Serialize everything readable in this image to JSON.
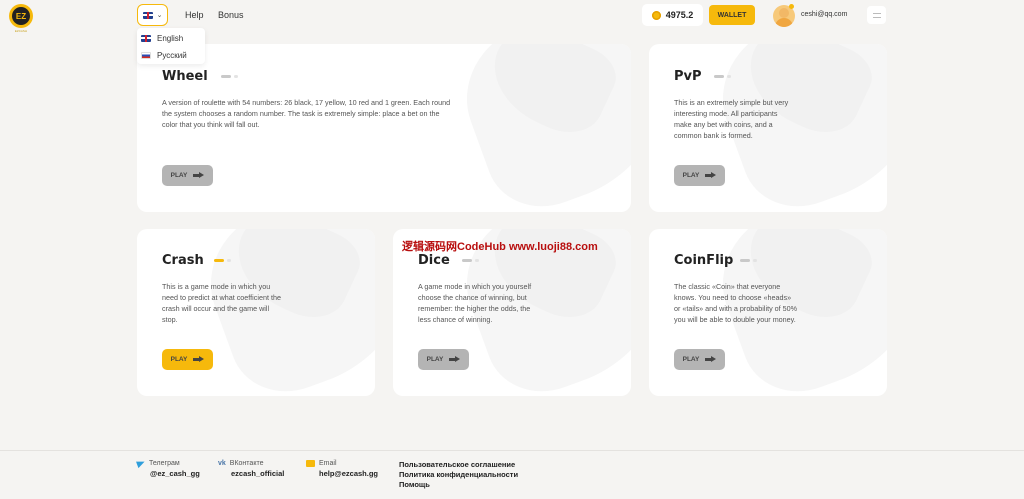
{
  "header": {
    "logo_text": "EZ",
    "logo_sub": "EZCASH",
    "nav": {
      "help": "Help",
      "bonus": "Bonus"
    },
    "languages": [
      {
        "label": "English",
        "flag": "uk-flag-icon"
      },
      {
        "label": "Русский",
        "flag": "ru-flag-icon"
      }
    ],
    "balance": "4975.2",
    "wallet_label": "WALLET",
    "user_email": "ceshi@qq.com"
  },
  "games": [
    {
      "title": "Wheel",
      "description": "A version of roulette with 54 numbers: 26 black, 17 yellow, 10 red and 1 green. Each round the system chooses a random number. The task is extremely simple: place a bet on the color that you think will fall out.",
      "play": "PLAY"
    },
    {
      "title": "PvP",
      "description": "This is an extremely simple but very interesting mode. All participants make any bet with coins, and a common bank is formed.",
      "play": "PLAY"
    },
    {
      "title": "Crash",
      "description": "This is a game mode in which you need to predict at what coefficient the crash will occur and the game will stop.",
      "play": "PLAY"
    },
    {
      "title": "Dice",
      "description": "A game mode in which you yourself choose the chance of winning, but remember: the higher the odds, the less chance of winning.",
      "play": "PLAY"
    },
    {
      "title": "CoinFlip",
      "description": "The classic «Coin» that everyone knows. You need to choose «heads» or «tails» and with a probability of 50% you will be able to double your money.",
      "play": "PLAY"
    }
  ],
  "watermark": "逻辑源码网CodeHub www.luoji88.com",
  "footer": {
    "telegram": {
      "label": "Телеграм",
      "value": "@ez_cash_gg"
    },
    "vk": {
      "label": "ВКонтакте",
      "value": "ezcash_official"
    },
    "email": {
      "label": "Email",
      "value": "help@ezcash.gg"
    },
    "links": [
      "Пользовательское соглашение",
      "Политика конфиденциальности",
      "Помощь"
    ]
  },
  "colors": {
    "accent": "#f6b90c",
    "background": "#f5f4f2",
    "card": "#ffffff",
    "button_gray": "#b4b4b4"
  }
}
